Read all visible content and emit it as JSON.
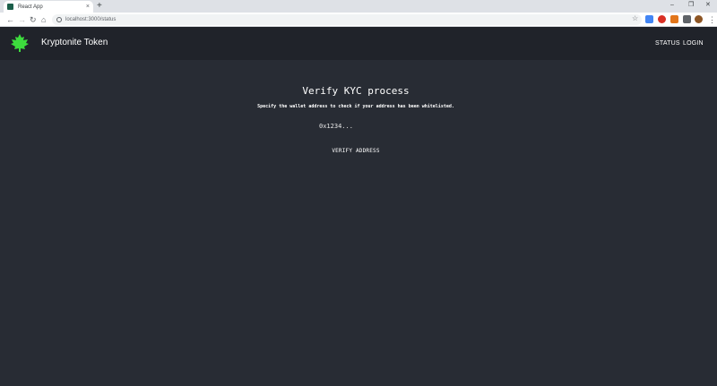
{
  "browser": {
    "tab_title": "React App",
    "tab_close": "×",
    "new_tab": "+",
    "url": "localhost:3000/status",
    "window_controls": {
      "minimize": "–",
      "restore": "❐",
      "close": "✕"
    },
    "nav": {
      "back": "←",
      "forward": "→",
      "reload": "↻",
      "home": "⌂"
    },
    "star": "☆",
    "menu": "⋮"
  },
  "header": {
    "brand": "Kryptonite Token",
    "logo_color": "#3ddc3d",
    "nav": {
      "status": "STATUS",
      "login": "LOGIN"
    }
  },
  "main": {
    "title": "Verify KYC process",
    "subtitle": "Specify the wallet address to check if your address has been whitelisted.",
    "address_input": {
      "placeholder": "0x1234...",
      "value": ""
    },
    "verify_button": "VERIFY ADDRESS"
  },
  "colors": {
    "page_bg": "#282c34",
    "header_bg": "#20232a",
    "accent_green": "#3ddc3d"
  }
}
